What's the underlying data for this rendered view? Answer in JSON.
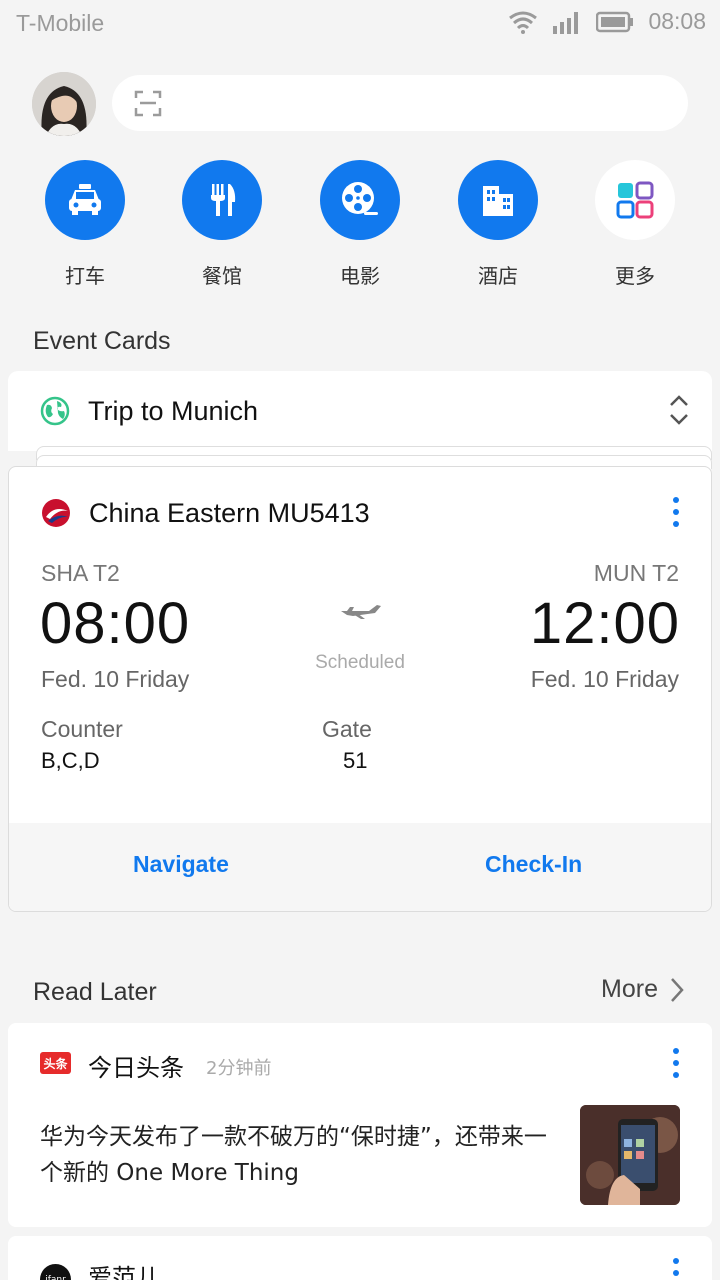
{
  "status_bar": {
    "carrier": "T-Mobile",
    "time": "08:08",
    "icons": [
      "wifi-icon",
      "signal-icon",
      "battery-icon"
    ]
  },
  "header": {
    "avatar": "user-avatar",
    "search_icon": "scan-icon"
  },
  "quick_actions": [
    {
      "label": "打车",
      "icon": "taxi-icon"
    },
    {
      "label": "餐馆",
      "icon": "restaurant-icon"
    },
    {
      "label": "电影",
      "icon": "film-reel-icon"
    },
    {
      "label": "酒店",
      "icon": "hotel-icon"
    },
    {
      "label": "更多",
      "icon": "apps-grid-icon"
    }
  ],
  "event_cards": {
    "section_title": "Event Cards",
    "trip": {
      "title": "Trip to Munich",
      "icon": "globe-icon"
    },
    "flight": {
      "title": "China Eastern MU5413",
      "origin": {
        "code": "SHA T2",
        "time": "08:00",
        "date": "Fed. 10  Friday"
      },
      "destination": {
        "code": "MUN T2",
        "time": "12:00",
        "date": "Fed. 10  Friday"
      },
      "status": "Scheduled",
      "counter_label": "Counter",
      "counter_value": "B,C,D",
      "gate_label": "Gate",
      "gate_value": "51",
      "actions": {
        "navigate": "Navigate",
        "checkin": "Check-In"
      }
    }
  },
  "read_later": {
    "section_title": "Read Later",
    "more_label": "More",
    "items": [
      {
        "source_icon_text": "头条",
        "source": "今日头条",
        "time": "2分钟前",
        "headline": "华为今天发布了一款不破万的“保时捷”，还带来一个新的 One More Thing"
      },
      {
        "source_icon_text": "ifanr",
        "source": "爱范儿"
      }
    ]
  },
  "colors": {
    "accent": "#1179ee",
    "background": "#f4f4f4",
    "card": "#ffffff"
  }
}
